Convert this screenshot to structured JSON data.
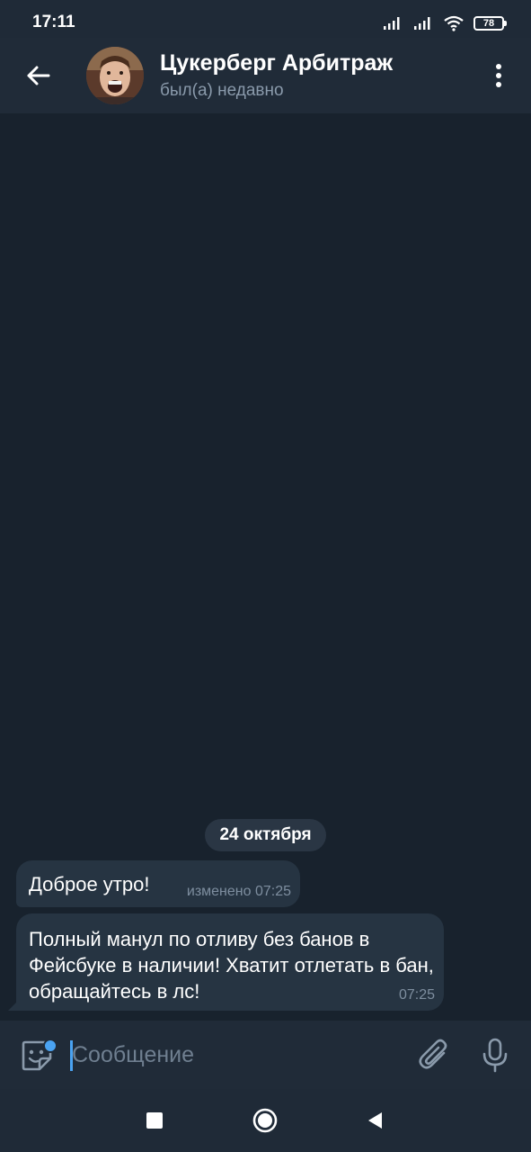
{
  "status_bar": {
    "time": "17:11",
    "battery": "78",
    "icons": [
      "signal-icon",
      "signal-icon",
      "wifi-icon",
      "battery-icon"
    ]
  },
  "header": {
    "title": "Цукерберг Арбитраж",
    "status": "был(а) недавно",
    "icons": [
      "back-arrow-icon",
      "more-vertical-icon"
    ]
  },
  "chat": {
    "date": "24 октября",
    "messages": [
      {
        "text": "Доброе утро!",
        "meta": "изменено 07:25"
      },
      {
        "text": "Полный манул по отливу без банов в Фейсбуке в наличии! Хватит отлетать в бан, обращайтесь в лс!",
        "meta": "07:25"
      }
    ]
  },
  "composer": {
    "placeholder": "Сообщение",
    "icons": [
      "sticker-icon",
      "attach-icon",
      "mic-icon"
    ]
  },
  "navigation": {
    "icons": [
      "recents-square-icon",
      "home-circle-icon",
      "back-triangle-icon"
    ]
  },
  "colors": {
    "background": "#18222d",
    "bar": "#202b38",
    "bubble": "#263442",
    "accent": "#4aa3f2",
    "secondary_text": "#8a9aab"
  }
}
